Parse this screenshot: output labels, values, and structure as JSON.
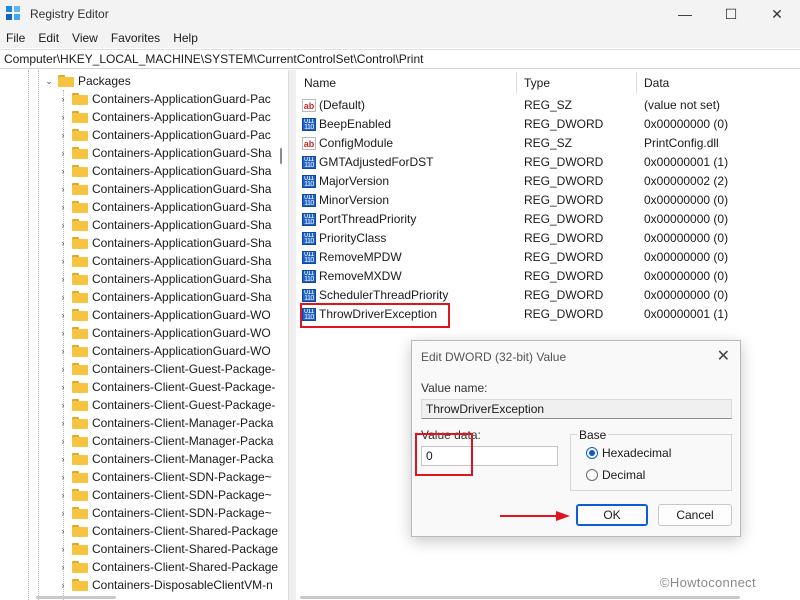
{
  "window": {
    "title": "Registry Editor",
    "minimize_glyph": "—",
    "maximize_glyph": "☐",
    "close_glyph": "✕"
  },
  "menu": [
    "File",
    "Edit",
    "View",
    "Favorites",
    "Help"
  ],
  "address": "Computer\\HKEY_LOCAL_MACHINE\\SYSTEM\\CurrentControlSet\\Control\\Print",
  "tree": {
    "parent": "Packages",
    "items": [
      "Containers-ApplicationGuard-Pac",
      "Containers-ApplicationGuard-Pac",
      "Containers-ApplicationGuard-Pac",
      "Containers-ApplicationGuard-Sha",
      "Containers-ApplicationGuard-Sha",
      "Containers-ApplicationGuard-Sha",
      "Containers-ApplicationGuard-Sha",
      "Containers-ApplicationGuard-Sha",
      "Containers-ApplicationGuard-Sha",
      "Containers-ApplicationGuard-Sha",
      "Containers-ApplicationGuard-Sha",
      "Containers-ApplicationGuard-Sha",
      "Containers-ApplicationGuard-WO",
      "Containers-ApplicationGuard-WO",
      "Containers-ApplicationGuard-WO",
      "Containers-Client-Guest-Package-",
      "Containers-Client-Guest-Package-",
      "Containers-Client-Guest-Package-",
      "Containers-Client-Manager-Packa",
      "Containers-Client-Manager-Packa",
      "Containers-Client-Manager-Packa",
      "Containers-Client-SDN-Package~",
      "Containers-Client-SDN-Package~",
      "Containers-Client-SDN-Package~",
      "Containers-Client-Shared-Package",
      "Containers-Client-Shared-Package",
      "Containers-Client-Shared-Package",
      "Containers-DisposableClientVM-n"
    ]
  },
  "list": {
    "headers": {
      "name": "Name",
      "type": "Type",
      "data": "Data"
    },
    "rows": [
      {
        "icon": "string-value-icon",
        "name": "(Default)",
        "type": "REG_SZ",
        "data": "(value not set)"
      },
      {
        "icon": "binary-value-icon",
        "name": "BeepEnabled",
        "type": "REG_DWORD",
        "data": "0x00000000 (0)"
      },
      {
        "icon": "string-value-icon",
        "name": "ConfigModule",
        "type": "REG_SZ",
        "data": "PrintConfig.dll"
      },
      {
        "icon": "binary-value-icon",
        "name": "GMTAdjustedForDST",
        "type": "REG_DWORD",
        "data": "0x00000001 (1)"
      },
      {
        "icon": "binary-value-icon",
        "name": "MajorVersion",
        "type": "REG_DWORD",
        "data": "0x00000002 (2)"
      },
      {
        "icon": "binary-value-icon",
        "name": "MinorVersion",
        "type": "REG_DWORD",
        "data": "0x00000000 (0)"
      },
      {
        "icon": "binary-value-icon",
        "name": "PortThreadPriority",
        "type": "REG_DWORD",
        "data": "0x00000000 (0)"
      },
      {
        "icon": "binary-value-icon",
        "name": "PriorityClass",
        "type": "REG_DWORD",
        "data": "0x00000000 (0)"
      },
      {
        "icon": "binary-value-icon",
        "name": "RemoveMPDW",
        "type": "REG_DWORD",
        "data": "0x00000000 (0)"
      },
      {
        "icon": "binary-value-icon",
        "name": "RemoveMXDW",
        "type": "REG_DWORD",
        "data": "0x00000000 (0)"
      },
      {
        "icon": "binary-value-icon",
        "name": "SchedulerThreadPriority",
        "type": "REG_DWORD",
        "data": "0x00000000 (0)"
      },
      {
        "icon": "binary-value-icon",
        "name": "ThrowDriverException",
        "type": "REG_DWORD",
        "data": "0x00000001 (1)"
      }
    ]
  },
  "dialog": {
    "title": "Edit DWORD (32-bit) Value",
    "value_name_label": "Value name:",
    "value_name": "ThrowDriverException",
    "value_data_label": "Value data:",
    "value_data": "0",
    "base_label": "Base",
    "hex_label": "Hexadecimal",
    "dec_label": "Decimal",
    "ok_label": "OK",
    "cancel_label": "Cancel",
    "close_glyph": "✕"
  },
  "watermark": "©Howtoconnect",
  "colors": {
    "highlight": "#e0141e",
    "accent": "#0b5cd5",
    "folder": "#f5c542"
  }
}
